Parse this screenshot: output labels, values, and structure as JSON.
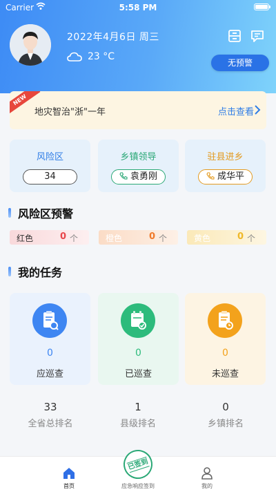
{
  "status_bar": {
    "carrier": "Carrier",
    "time": "5:58 PM"
  },
  "header": {
    "date": "2022年4月6日  周三",
    "weather_icon": "cloud-icon",
    "temperature": "23 °C",
    "alert_status": "无预警"
  },
  "banner": {
    "ribbon": "NEW",
    "title": "地灾智治\"浙\"一年",
    "link": "点击查看"
  },
  "info_cards": [
    {
      "title": "风险区",
      "value": "34",
      "color": "#2f7de6"
    },
    {
      "title": "乡镇领导",
      "value": "袁勇刚",
      "color": "#2aa876"
    },
    {
      "title": "驻县进乡",
      "value": "成华平",
      "color": "#e39a1f"
    }
  ],
  "risk_section": {
    "title": "风险区预警",
    "levels": [
      {
        "label": "红色",
        "count": "0",
        "unit": "个",
        "color": "#e8454a"
      },
      {
        "label": "橙色",
        "count": "0",
        "unit": "个",
        "color": "#f07a2a"
      },
      {
        "label": "黄色",
        "count": "0",
        "unit": "个",
        "color": "#efb828"
      }
    ]
  },
  "task_section": {
    "title": "我的任务",
    "cards": [
      {
        "label": "应巡查",
        "count": "0",
        "color": "#3e86f2"
      },
      {
        "label": "已巡查",
        "count": "0",
        "color": "#2dbb7c"
      },
      {
        "label": "未巡查",
        "count": "0",
        "color": "#f3a21c"
      }
    ]
  },
  "rankings": [
    {
      "value": "33",
      "label": "全省总排名"
    },
    {
      "value": "1",
      "label": "县级排名"
    },
    {
      "value": "0",
      "label": "乡镇排名"
    }
  ],
  "tabbar": {
    "home": "首页",
    "checkin": "应急响应签到",
    "checkin_stamp": "已签到",
    "mine": "我的"
  }
}
